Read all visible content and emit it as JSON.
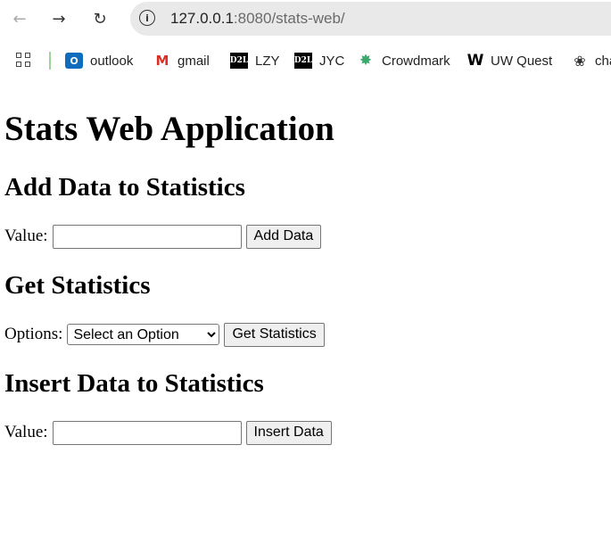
{
  "browser": {
    "url_host": "127.0.0.1",
    "url_rest": ":8080/stats-web/",
    "back_icon": "arrow-left",
    "forward_icon": "arrow-right",
    "reload_icon": "reload",
    "info_icon": "info-circle"
  },
  "bookmarks": [
    {
      "label": "outlook",
      "icon": "outlook-icon"
    },
    {
      "label": "gmail",
      "icon": "gmail-icon"
    },
    {
      "label": "LZY",
      "icon": "d2l-icon"
    },
    {
      "label": "JYC",
      "icon": "d2l-icon"
    },
    {
      "label": "Crowdmark",
      "icon": "crowdmark-icon"
    },
    {
      "label": "UW Quest",
      "icon": "w-icon"
    },
    {
      "label": "cha",
      "icon": "chatgpt-icon"
    }
  ],
  "page": {
    "title": "Stats Web Application",
    "add_section": {
      "heading": "Add Data to Statistics",
      "value_label": "Value:",
      "value": "",
      "button": "Add Data"
    },
    "get_section": {
      "heading": "Get Statistics",
      "options_label": "Options:",
      "selected_option": "Select an Option",
      "button": "Get Statistics"
    },
    "insert_section": {
      "heading": "Insert Data to Statistics",
      "value_label": "Value:",
      "value": "",
      "button": "Insert Data"
    }
  }
}
